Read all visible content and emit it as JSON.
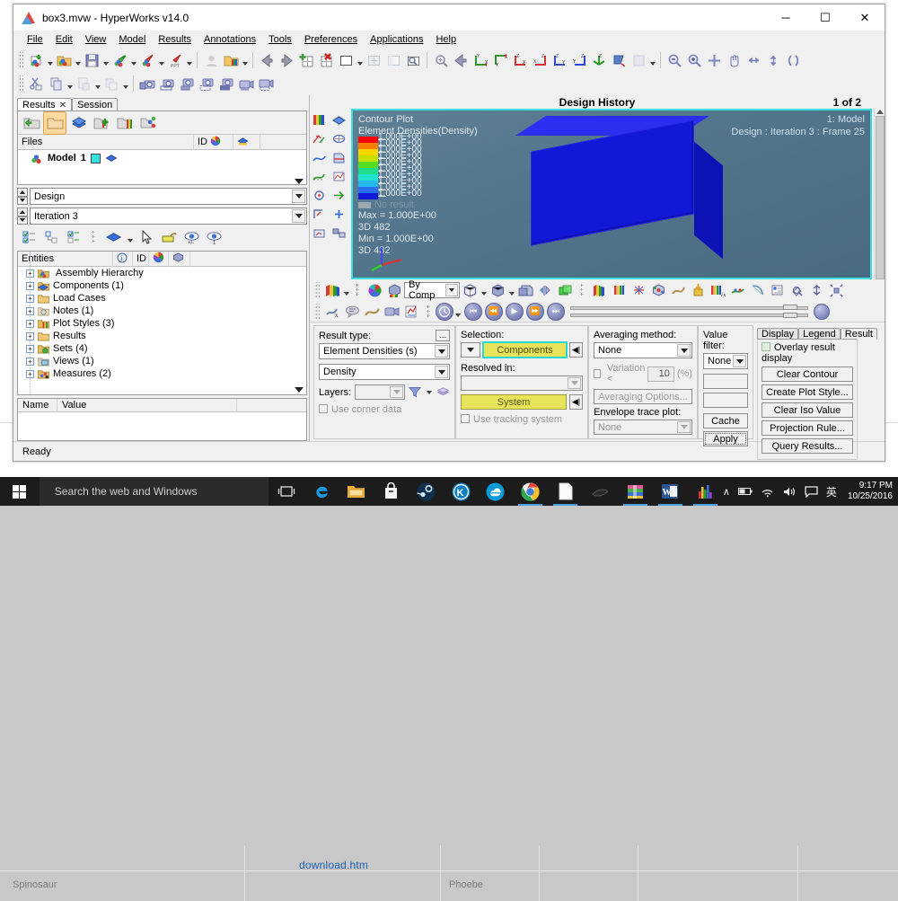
{
  "window": {
    "title": "box3.mvw - HyperWorks v14.0",
    "icon": "hyperworks-logo-icon",
    "minimize": "─",
    "maximize": "☐",
    "close": "✕"
  },
  "menubar": {
    "items": [
      {
        "label": "File"
      },
      {
        "label": "Edit"
      },
      {
        "label": "View"
      },
      {
        "label": "Model"
      },
      {
        "label": "Results"
      },
      {
        "label": "Annotations"
      },
      {
        "label": "Tools"
      },
      {
        "label": "Preferences"
      },
      {
        "label": "Applications"
      },
      {
        "label": "Help"
      }
    ]
  },
  "toolbar_row1": {
    "groups": [
      {
        "buttons": [
          "new-session-icon",
          "open-model-icon",
          "save-session-icon",
          "import-icon",
          "export-icon",
          "export-ppt-icon"
        ]
      },
      {
        "buttons": [
          "user-profile-icon",
          "load-results-icon"
        ]
      },
      {
        "buttons": [
          "previous-page-icon",
          "next-page-icon",
          "add-page-icon",
          "delete-page-icon",
          "single-window-icon",
          "fit-window-icon",
          "resize-window-icon",
          "page-window-icon"
        ]
      },
      {
        "buttons": [
          "fit-view-icon",
          "previous-view-icon",
          "view-xy-icon",
          "view-yx-icon",
          "view-zx-icon",
          "view-xz-icon",
          "view-zy-icon",
          "view-yz-icon",
          "view-iso-icon",
          "rotate-view-icon",
          "apply-style-icon"
        ]
      },
      {
        "buttons": [
          "zoom-out-icon",
          "zoom-in-icon",
          "fit-all-icon",
          "pan-icon",
          "rotate-h-icon",
          "rotate-v-icon",
          "orbit-icon"
        ]
      }
    ]
  },
  "toolbar_row2": {
    "groups": [
      {
        "buttons": [
          "cut-icon",
          "copy-icon",
          "paste-icon",
          "paste-special-icon"
        ]
      },
      {
        "buttons": [
          "save-capture-icon",
          "capture-window-icon",
          "capture-region-icon",
          "capture-custom-icon",
          "capture-full-icon",
          "record-video-icon",
          "record-region-icon"
        ]
      }
    ]
  },
  "left_panel": {
    "tabs": [
      {
        "label": "Results",
        "closable": true,
        "active": true
      },
      {
        "label": "Session",
        "closable": false,
        "active": false
      }
    ],
    "browser_buttons": [
      "open-model-folder-icon",
      "model-folder-selected-icon",
      "results-browser-icon",
      "add-result-icon",
      "plot-styles-icon",
      "share-icon"
    ],
    "files_grid": {
      "columns": [
        "Files",
        "ID",
        "color-wheel-icon",
        "visibility-icon"
      ],
      "rows": [
        {
          "name": "Model",
          "id": "1",
          "color": "#35e0e0",
          "icon": "model-icon"
        }
      ]
    },
    "subcase_select": {
      "value": "Design",
      "options": [
        "Design"
      ]
    },
    "iteration_select": {
      "value": "Iteration 3",
      "options": [
        "Iteration 3"
      ]
    },
    "tree_toolbar": [
      "expand-all-icon",
      "collapse-all-icon",
      "sync-selection-icon",
      "component-display-icon",
      "pointer-icon",
      "isolate-icon",
      "show-hide-icon",
      "show-only-icon"
    ],
    "entities_grid": {
      "columns": [
        "Entities",
        "info-icon",
        "ID",
        "color-wheel-icon",
        "display-icon"
      ],
      "rows": [
        {
          "label": "Assembly Hierarchy",
          "icon": "assembly-icon"
        },
        {
          "label": "Components (1)",
          "icon": "components-icon"
        },
        {
          "label": "Load Cases",
          "icon": "folder-icon"
        },
        {
          "label": "Notes (1)",
          "icon": "notes-icon"
        },
        {
          "label": "Plot Styles (3)",
          "icon": "plot-styles-icon"
        },
        {
          "label": "Results",
          "icon": "folder-icon"
        },
        {
          "label": "Sets  (4)",
          "icon": "sets-icon"
        },
        {
          "label": "Views (1)",
          "icon": "views-icon"
        },
        {
          "label": "Measures (2)",
          "icon": "measures-icon"
        }
      ]
    },
    "name_value_grid": {
      "columns": [
        "Name",
        "Value"
      ],
      "rows": []
    }
  },
  "graphics": {
    "header_title": "Design History",
    "page_indicator": "1 of 2",
    "vertical_tools": [
      "contour-icon",
      "iso-icon",
      "vector-icon",
      "tensor-icon",
      "streamline-icon",
      "section-cut-icon",
      "deformed-icon",
      "transient-icon",
      "tracking-icon",
      "fast-track-icon",
      "free-body-icon",
      "linear-superposition-icon",
      "derived-load-icon",
      "exploded-view-icon"
    ],
    "overlay": {
      "line1": "Contour Plot",
      "line2": "Element Densities(Density)",
      "max_label": "Max = 1.000E+00",
      "max_elem": "3D 482",
      "min_label": "Min = 1.000E+00",
      "min_elem": "3D 432",
      "no_result": "No result",
      "model_label": "1: Model",
      "frame_label": "Design : Iteration 3 : Frame 25"
    },
    "legend": {
      "values": [
        "1.000E+00",
        "1.000E+00",
        "1.000E+00",
        "1.000E+00",
        "1.000E+00",
        "1.000E+00",
        "1.000E+00",
        "1.000E+00",
        "1.000E+00",
        "1.000E+00"
      ],
      "colors": [
        "#ff0000",
        "#ff7f00",
        "#ffd400",
        "#c8e000",
        "#55dd22",
        "#1ddd8a",
        "#20e0d0",
        "#25b9ee",
        "#2a6ff0",
        "#1218d8"
      ]
    }
  },
  "contour_toolbar": {
    "items": [
      "contour-plot-icon",
      "color-wheel-icon",
      "legend-cube-icon",
      "cube-wire-icon",
      "cube-solid-icon",
      "shaded-mesh-icon",
      "symmetry-icon",
      "transparent-icon"
    ],
    "mode_select": {
      "value": "By Comp",
      "options": [
        "By Comp"
      ]
    },
    "right_items": [
      "contour-icon",
      "iso-value-icon",
      "vector-plot-icon",
      "tensor-plot-icon",
      "streamline-icon",
      "section-cut-icon",
      "deformed-shape-icon",
      "math-result-icon",
      "tracking-icon",
      "free-body-diagram-icon",
      "notes-icon",
      "measures-icon",
      "explode-icon"
    ]
  },
  "anim_toolbar": {
    "items": [
      "math-x-icon",
      "note-icon",
      "deform-icon",
      "video-icon",
      "report-icon"
    ],
    "clock_icon": "animation-clock-icon",
    "controls": [
      "skip-start-icon",
      "rewind-icon",
      "play-icon",
      "fast-forward-icon",
      "skip-end-icon"
    ],
    "settings_icon": "animation-settings-icon"
  },
  "result_controls": {
    "result_type": {
      "label": "Result type:",
      "browse_label": "...",
      "primary": {
        "value": "Element Densities (s)",
        "options": [
          "Element Densities (s)"
        ]
      },
      "secondary": {
        "value": "Density",
        "options": [
          "Density"
        ]
      },
      "layers_label": "Layers:",
      "layers": {
        "value": "",
        "options": []
      },
      "filter_icon": "funnel-icon",
      "layers_icon": "layers-icon",
      "use_corner_data": {
        "label": "Use corner data",
        "checked": false,
        "enabled": false
      }
    },
    "selection": {
      "label": "Selection:",
      "components_button": "Components",
      "reset_icon": "◀|",
      "resolved_in_label": "Resolved in:",
      "resolved_in": {
        "value": "",
        "options": []
      },
      "system_button": "System",
      "use_tracking_system": {
        "label": "Use tracking system",
        "checked": false,
        "enabled": false
      }
    },
    "averaging": {
      "label": "Averaging method:",
      "method": {
        "value": "None",
        "options": [
          "None"
        ]
      },
      "variation_label": "Variation <",
      "variation_value": "10",
      "variation_unit": "(%)",
      "options_button": "Averaging Options...",
      "envelope_label": "Envelope trace plot:",
      "envelope": {
        "value": "None",
        "options": [
          "None"
        ]
      }
    },
    "value_filter": {
      "label": "Value filter:",
      "filter": {
        "value": "None",
        "options": [
          "None"
        ]
      },
      "field_min": "",
      "field_max": "",
      "cache_button": "Cache",
      "apply_button": "Apply"
    },
    "right_tabs": {
      "tabs": [
        {
          "label": "Display",
          "active": false
        },
        {
          "label": "Legend",
          "active": false
        },
        {
          "label": "Result",
          "active": true
        }
      ],
      "overlay_checkbox": {
        "label": "Overlay result display",
        "checked": false
      },
      "buttons": [
        "Clear Contour",
        "Create Plot Style...",
        "Clear Iso Value",
        "Projection Rule...",
        "Query Results..."
      ]
    }
  },
  "statusbar": {
    "text": "Ready"
  },
  "background": {
    "link": "download.htm",
    "left_text": "Spinosaur",
    "mid_text": "Phoebe"
  },
  "taskbar": {
    "start_icon": "windows-logo-icon",
    "search_placeholder": "Search the web and Windows",
    "taskview_icon": "task-view-icon",
    "pinned": [
      {
        "icon": "edge-icon",
        "active": false
      },
      {
        "icon": "file-explorer-icon",
        "active": false
      },
      {
        "icon": "store-icon",
        "active": false
      },
      {
        "icon": "steam-icon",
        "active": false
      },
      {
        "icon": "kmplayer-icon",
        "active": false
      },
      {
        "icon": "cloud-icon",
        "active": false
      },
      {
        "icon": "chrome-icon",
        "active": true
      },
      {
        "icon": "notepad-icon",
        "active": true
      },
      {
        "icon": "tool-icon",
        "active": false
      },
      {
        "icon": "winrar-icon",
        "active": true
      },
      {
        "icon": "word-icon",
        "active": true
      },
      {
        "icon": "hyperworks-icon",
        "active": true
      }
    ],
    "tray": {
      "chevron": "∧",
      "battery_icon": "battery-icon",
      "wifi_icon": "wifi-icon",
      "volume_icon": "volume-icon",
      "action_center_icon": "action-center-icon",
      "ime_label": "英",
      "time": "9:17 PM",
      "date": "10/25/2016"
    }
  }
}
